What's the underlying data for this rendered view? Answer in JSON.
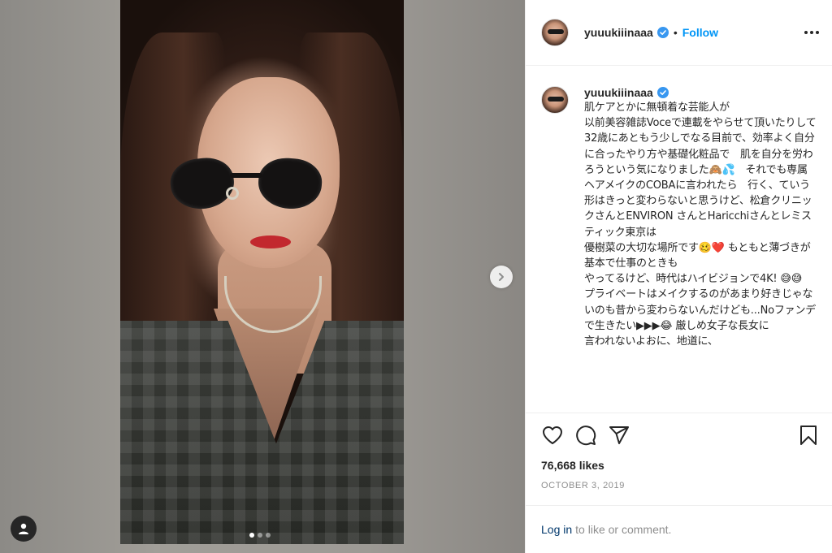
{
  "post": {
    "username": "yuuukiiinaaa",
    "follow_label": "Follow",
    "separator": "•",
    "caption": "肌ケアとかに無頓着な芸能人が\n以前美容雑誌Voceで連載をやらせて頂いたりして　32歳にあともう少しでなる目前で、効率よく自分に合ったやり方や基礎化粧品で　肌を自分を労わろうという気になりました🙈💦　それでも専属ヘアメイクのCOBAに言われたら　行く、ていう形はきっと変わらないと思うけど、松倉クリニックさんとENVIRON さんとHaricchiさんとレミスティック東京は\n優樹菜の大切な場所です🥴❤️ もともと薄づきが基本で仕事のときも\nやってるけど、時代はハイビジョンで4K! 😅😅\nプライベートはメイクするのがあまり好きじゃないのも昔から変わらないんだけども...Noファンデで生きたい▶▶▶😂 厳しめ女子な長女に\n言われないよおに、地道に、",
    "likes": "76,668 likes",
    "date": "OCTOBER 3, 2019"
  },
  "carousel": {
    "total": 3,
    "active": 0
  },
  "footer": {
    "login_link": "Log in",
    "login_text": "to like or comment."
  },
  "icons": {
    "verified": "verified-badge-icon",
    "more": "more-options-icon",
    "like": "heart-icon",
    "comment": "comment-icon",
    "share": "share-icon",
    "save": "bookmark-icon",
    "next": "chevron-right-icon",
    "profile": "user-icon"
  },
  "colors": {
    "accent": "#0095f6",
    "link": "#00376b",
    "muted": "#8e8e8e",
    "text": "#262626"
  }
}
